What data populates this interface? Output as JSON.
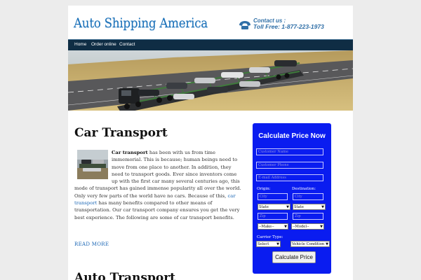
{
  "header": {
    "logo": "Auto Shipping America",
    "contact_line1": "Contact us :",
    "contact_line2": "Toll Free: 1-877-223-1973"
  },
  "nav": {
    "items": [
      "Home",
      "Order online",
      "Contact"
    ]
  },
  "main": {
    "title": "Car Transport",
    "article_lead": "Car transport",
    "article_text_1": " has been with us from time immemorial. This is because; human beings need to move from one place to another. In addition, they need to transport goods. Ever since inventors come up with the first car many several centuries ago, this mode of transport has gained immense popularity all over the world. Only very few parts of the world have no cars. Because of this, ",
    "article_link": "car transport",
    "article_text_2": " has many benefits compared to other means of transportation. Our car transport company ensures you get the very best experience. The following are some of car transport benefits.",
    "read_more": "READ MORE",
    "second_title": "Auto Transport"
  },
  "calculator": {
    "title": "Calculate Price Now",
    "name_placeholder": "Customer Name",
    "phone_placeholder": "Customer Phone",
    "email_placeholder": "E-mail Address",
    "origin_label": "Origin:",
    "destination_label": "Destination:",
    "city_placeholder": "City",
    "state_option": "State",
    "zip_placeholder": "Zip",
    "make_option": "--Make--",
    "model_option": "--Model--",
    "carrier_label": "Carrier Type:",
    "carrier_option": "Select",
    "condition_option": "Vehicle Condition",
    "button": "Calculate Price"
  },
  "colors": {
    "nav_bg": "#0f2d44",
    "calc_bg": "#0a1cf0",
    "logo": "#1a70b8",
    "link": "#1a66b5"
  }
}
